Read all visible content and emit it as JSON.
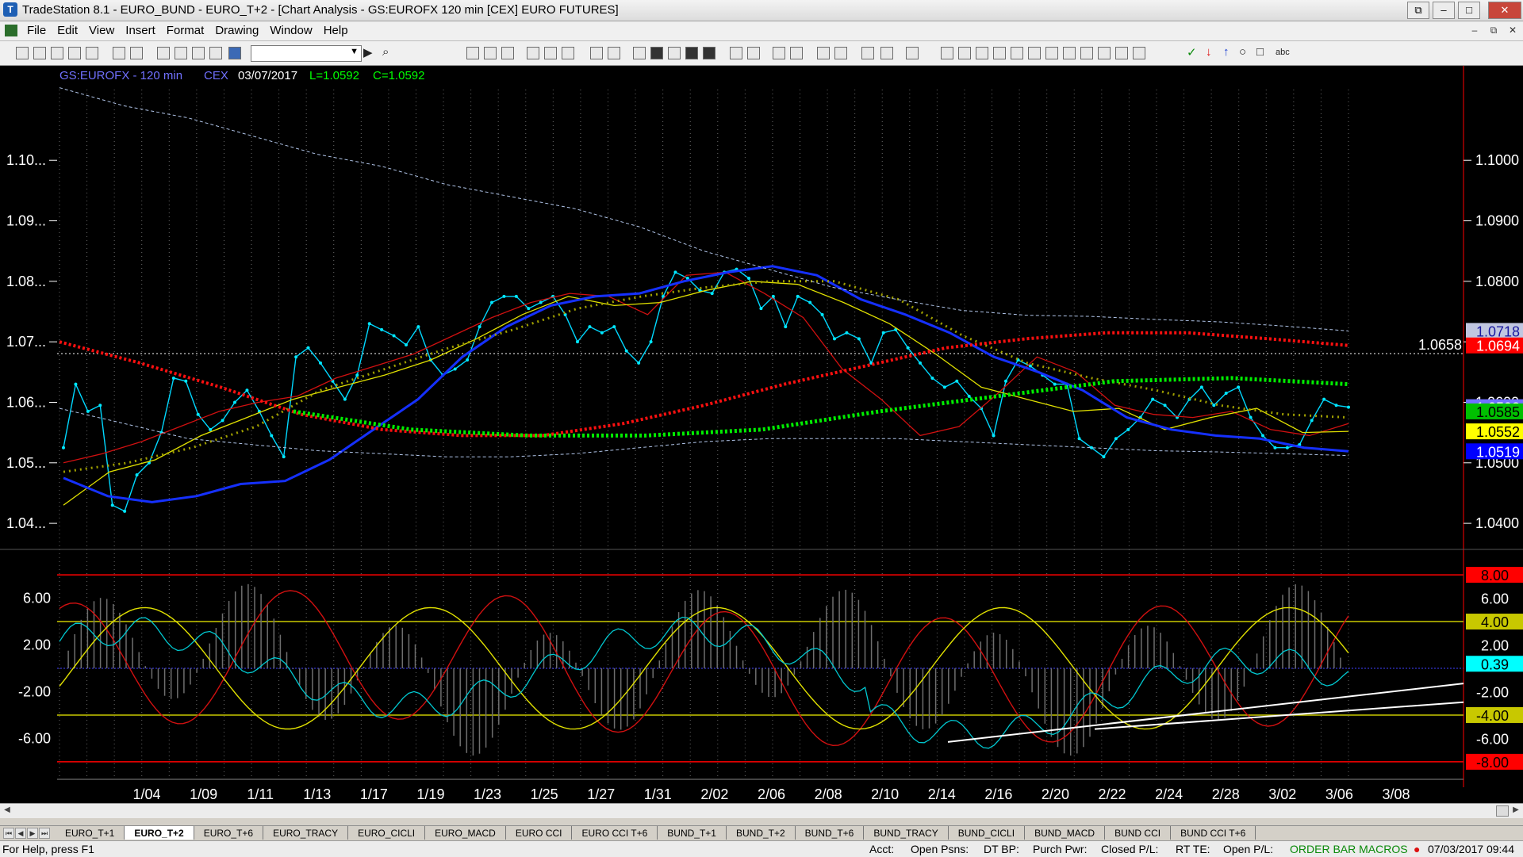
{
  "window": {
    "title": "TradeStation 8.1 - EURO_BUND - EURO_T+2 - [Chart Analysis - GS:EUROFX  120 min  [CEX] EURO FUTURES]"
  },
  "menu": [
    "File",
    "Edit",
    "View",
    "Insert",
    "Format",
    "Drawing",
    "Window",
    "Help"
  ],
  "chart": {
    "header": {
      "symbol": "GS:EUROFX - 120 min",
      "exchange": "CEX",
      "date": "03/07/2017",
      "low": "L=1.0592",
      "close": "C=1.0592"
    },
    "left_price_ticks": [
      "1.10...",
      "1.09...",
      "1.08...",
      "1.07...",
      "1.06...",
      "1.05...",
      "1.04..."
    ],
    "right_price_ticks": [
      "1.1000",
      "1.0900",
      "1.0800",
      "1.0700",
      "1.0600",
      "1.0500",
      "1.0400"
    ],
    "price_line_label": "1.0658",
    "right_badges": [
      {
        "text": "1.0718",
        "bg": "#c0c6e0",
        "fg": "#1a1aa0"
      },
      {
        "text": "1.0694",
        "bg": "#ff0000",
        "fg": "#ffffff"
      },
      {
        "text": "1.0592",
        "bg": "#7070ff",
        "fg": "#ffffff"
      },
      {
        "text": "1.0585",
        "bg": "#00c000",
        "fg": "#000000"
      },
      {
        "text": "1.0552",
        "bg": "#ffff00",
        "fg": "#000000"
      },
      {
        "text": "1.0519",
        "bg": "#0000ff",
        "fg": "#ffffff"
      }
    ],
    "osc_left_ticks": [
      "6.00",
      "2.00",
      "-2.00",
      "-6.00"
    ],
    "osc_right_ticks": [
      {
        "text": "8.00",
        "bg": "#ff0000",
        "fg": "#000000"
      },
      {
        "text": "6.00",
        "bg": "",
        "fg": "#ffffff"
      },
      {
        "text": "4.00",
        "bg": "#c8c800",
        "fg": "#000000"
      },
      {
        "text": "2.00",
        "bg": "",
        "fg": "#ffffff"
      },
      {
        "text": "0.39",
        "bg": "#00ffff",
        "fg": "#000000"
      },
      {
        "text": "-2.00",
        "bg": "",
        "fg": "#ffffff"
      },
      {
        "text": "-4.00",
        "bg": "#c8c800",
        "fg": "#000000"
      },
      {
        "text": "-6.00",
        "bg": "",
        "fg": "#ffffff"
      },
      {
        "text": "-8.00",
        "bg": "#ff0000",
        "fg": "#000000"
      }
    ],
    "date_labels": [
      "1/04",
      "1/09",
      "1/11",
      "1/13",
      "1/17",
      "1/19",
      "1/23",
      "1/25",
      "1/27",
      "1/31",
      "2/02",
      "2/06",
      "2/08",
      "2/10",
      "2/14",
      "2/16",
      "2/20",
      "2/22",
      "2/24",
      "2/28",
      "3/02",
      "3/06",
      "3/08"
    ]
  },
  "chart_data": {
    "type": "line",
    "price_axis": {
      "ylim": [
        1.037,
        1.113
      ]
    },
    "series": [
      {
        "values": [
          1.0525,
          1.063,
          1.0585,
          1.0595,
          1.043,
          1.042,
          1.048,
          1.05,
          1.055,
          1.064,
          1.0635,
          1.058,
          1.0555,
          1.057,
          1.06,
          1.062,
          1.0585,
          1.0545,
          1.051,
          1.0675,
          1.069,
          1.0665,
          1.0635,
          1.0605,
          1.0645,
          1.073,
          1.072,
          1.071,
          1.0695,
          1.0725,
          1.067,
          1.0645,
          1.0655,
          1.067,
          1.0725,
          1.0765,
          1.0775,
          1.0775,
          1.0755,
          1.0765,
          1.0775,
          1.0745,
          1.07,
          1.0725,
          1.0715,
          1.0725,
          1.0685,
          1.0665,
          1.07,
          1.0775,
          1.0815,
          1.0805,
          1.0785,
          1.078,
          1.0815,
          1.082,
          1.0805,
          1.0755,
          1.0775,
          1.0725,
          1.0775,
          1.0765,
          1.0745,
          1.0705,
          1.0715,
          1.0705,
          1.0665,
          1.0715,
          1.072,
          1.069,
          1.0665,
          1.064,
          1.0625,
          1.0635,
          1.061,
          1.059,
          1.0545,
          1.0635,
          1.067,
          1.066,
          1.0645,
          1.063,
          1.063,
          1.054,
          1.0525,
          1.051,
          1.054,
          1.0555,
          1.0575,
          1.0605,
          1.0595,
          1.0575,
          1.0605,
          1.0625,
          1.0595,
          1.0615,
          1.0625,
          1.0575,
          1.0545,
          1.0525,
          1.0525,
          1.053,
          1.057,
          1.0605,
          1.0595,
          1.0592
        ]
      },
      {
        "values": [
          1.05,
          1.0515,
          1.0535,
          1.056,
          1.0585,
          1.06,
          1.061,
          1.064,
          1.066,
          1.068,
          1.071,
          1.074,
          1.0765,
          1.078,
          1.0775,
          1.0745,
          1.081,
          1.0815,
          1.078,
          1.074,
          1.0655,
          1.0605,
          1.0545,
          1.056,
          1.0615,
          1.0675,
          1.065,
          1.0595,
          1.058,
          1.0575,
          1.0585,
          1.0555,
          1.0545,
          1.0565
        ]
      },
      {
        "values": [
          1.043,
          1.0485,
          1.0505,
          1.0545,
          1.0575,
          1.0605,
          1.0625,
          1.0645,
          1.067,
          1.0705,
          1.0745,
          1.0775,
          1.076,
          1.0765,
          1.0785,
          1.08,
          1.0795,
          1.0765,
          1.073,
          1.068,
          1.0625,
          1.0605,
          1.0585,
          1.059,
          1.0555,
          1.0575,
          1.059,
          1.055,
          1.0552
        ]
      },
      {
        "values": [
          1.0475,
          1.0445,
          1.0435,
          1.0445,
          1.0465,
          1.047,
          1.0505,
          1.0555,
          1.0605,
          1.0675,
          1.0725,
          1.076,
          1.0775,
          1.078,
          1.08,
          1.0815,
          1.0825,
          1.081,
          1.077,
          1.0745,
          1.0715,
          1.0675,
          1.065,
          1.062,
          1.0575,
          1.0555,
          1.0545,
          1.054,
          1.0525,
          1.0519
        ]
      },
      {
        "values": [
          1.0485,
          1.05,
          1.0525,
          1.056,
          1.062,
          1.0655,
          1.069,
          1.072,
          1.0755,
          1.0775,
          1.079,
          1.08,
          1.08,
          1.077,
          1.071,
          1.0665,
          1.064,
          1.062,
          1.0595,
          1.058,
          1.0575
        ]
      },
      {
        "values": [
          1.07,
          1.0665,
          1.0625,
          1.058,
          1.0555,
          1.0545,
          1.0545,
          1.0565,
          1.0595,
          1.063,
          1.066,
          1.069,
          1.0705,
          1.0715,
          1.0715,
          1.0705,
          1.0694
        ]
      },
      {
        "values": [
          1.0585,
          1.0555,
          1.0545,
          1.0545,
          1.0555,
          1.0585,
          1.061,
          1.0635,
          1.064,
          1.063
        ]
      }
    ],
    "oscillator": {
      "ylim": [
        -9.5,
        9.5
      ],
      "bands": [
        8,
        4,
        -4,
        -8
      ],
      "zero": 0
    }
  }
}
